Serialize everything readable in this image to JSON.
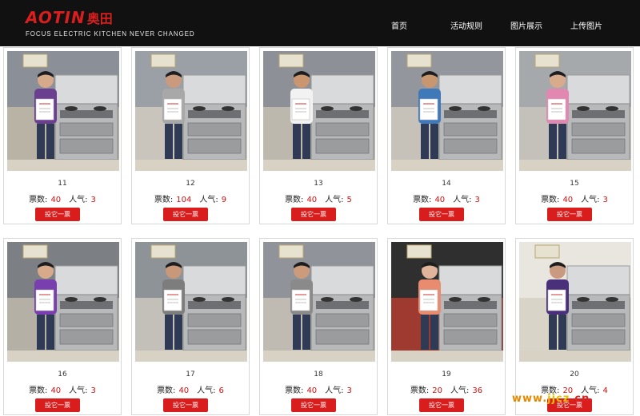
{
  "header": {
    "logo_word": "AOTIN",
    "logo_cn": "奥田",
    "tagline": "FOCUS ELECTRIC KITCHEN NEVER CHANGED",
    "nav": [
      {
        "label": "首页"
      },
      {
        "label": "活动规则"
      },
      {
        "label": "图片展示"
      },
      {
        "label": "上传图片"
      }
    ]
  },
  "labels": {
    "votes": "票数:",
    "popularity": "人气:",
    "vote_button": "投它一票"
  },
  "cards": [
    {
      "number": "11",
      "votes": "40",
      "popularity": "3"
    },
    {
      "number": "12",
      "votes": "104",
      "popularity": "9"
    },
    {
      "number": "13",
      "votes": "40",
      "popularity": "5"
    },
    {
      "number": "14",
      "votes": "40",
      "popularity": "3"
    },
    {
      "number": "15",
      "votes": "40",
      "popularity": "3"
    },
    {
      "number": "16",
      "votes": "40",
      "popularity": "3"
    },
    {
      "number": "17",
      "votes": "40",
      "popularity": "6"
    },
    {
      "number": "18",
      "votes": "40",
      "popularity": "3"
    },
    {
      "number": "19",
      "votes": "20",
      "popularity": "36"
    },
    {
      "number": "20",
      "votes": "20",
      "popularity": "4"
    }
  ],
  "watermark": {
    "part1": "www.",
    "part2": "jjcz",
    "part3": ".cn"
  },
  "colors": {
    "accent": "#d91c1c",
    "header_bg": "#111111",
    "value": "#cc1111"
  }
}
